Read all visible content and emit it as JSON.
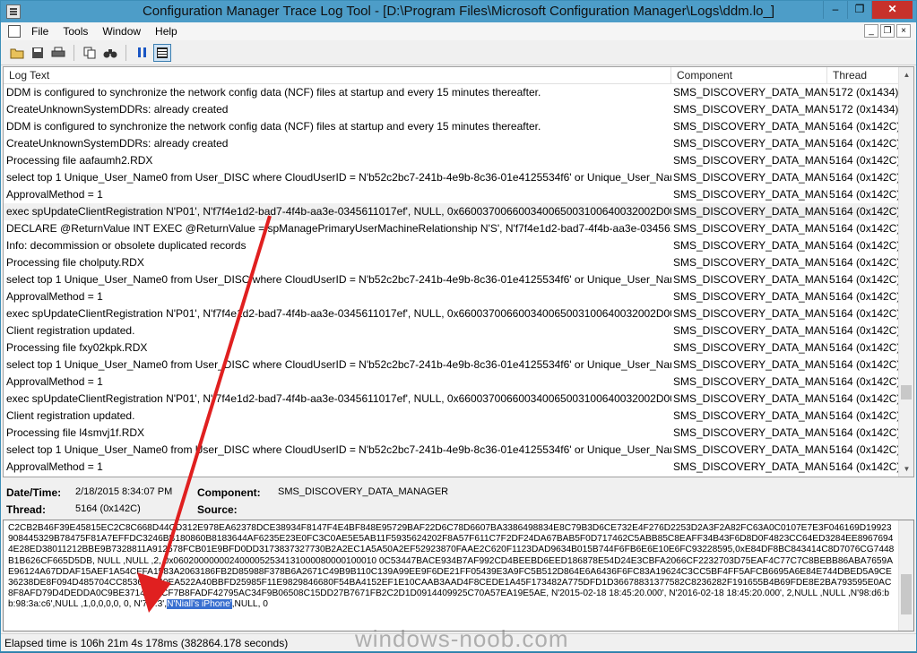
{
  "titlebar": {
    "title": "Configuration Manager Trace Log Tool - [D:\\Program Files\\Microsoft Configuration Manager\\Logs\\ddm.lo_]",
    "minimize": "–",
    "restore": "❐",
    "close": "✕"
  },
  "menu": {
    "file": "File",
    "tools": "Tools",
    "window": "Window",
    "help": "Help",
    "mdi_min": "_",
    "mdi_restore": "❐",
    "mdi_close": "×"
  },
  "columns": {
    "text": "Log Text",
    "component": "Component",
    "thread": "Thread"
  },
  "rows": [
    {
      "text": "DDM is configured to synchronize the network config data (NCF) files at startup and every 15 minutes thereafter.",
      "component": "SMS_DISCOVERY_DATA_MANA",
      "thread": "5172 (0x1434)"
    },
    {
      "text": "CreateUnknownSystemDDRs: already created",
      "component": "SMS_DISCOVERY_DATA_MANA",
      "thread": "5172 (0x1434)"
    },
    {
      "text": "DDM is configured to synchronize the network config data (NCF) files at startup and every 15 minutes thereafter.",
      "component": "SMS_DISCOVERY_DATA_MANA",
      "thread": "5164 (0x142C)"
    },
    {
      "text": "CreateUnknownSystemDDRs: already created",
      "component": "SMS_DISCOVERY_DATA_MANA",
      "thread": "5164 (0x142C)"
    },
    {
      "text": "Processing file aafaumh2.RDX",
      "component": "SMS_DISCOVERY_DATA_MANA",
      "thread": "5164 (0x142C)"
    },
    {
      "text": "select top 1 Unique_User_Name0 from User_DISC where CloudUserID = N'b52c2bc7-241b-4e9b-8c36-01e4125534f6' or Unique_User_Name...",
      "component": "SMS_DISCOVERY_DATA_MANA",
      "thread": "5164 (0x142C)"
    },
    {
      "text": "ApprovalMethod = 1",
      "component": "SMS_DISCOVERY_DATA_MANA",
      "thread": "5164 (0x142C)"
    },
    {
      "text": "exec spUpdateClientRegistration N'P01', N'f7f4e1d2-bad7-4f4b-aa3e-0345611017ef', NULL, 0x660037006600340065003100640032002D00620...",
      "component": "SMS_DISCOVERY_DATA_MANA",
      "thread": "5164 (0x142C)",
      "selected": true
    },
    {
      "text": "DECLARE @ReturnValue INT EXEC @ReturnValue = spManagePrimaryUserMachineRelationship N'S', N'f7f4e1d2-bad7-4f4b-aa3e-0345611...",
      "component": "SMS_DISCOVERY_DATA_MANA",
      "thread": "5164 (0x142C)"
    },
    {
      "text": "Info: decommission or obsolete duplicated records",
      "component": "SMS_DISCOVERY_DATA_MANA",
      "thread": "5164 (0x142C)"
    },
    {
      "text": "Processing file cholputy.RDX",
      "component": "SMS_DISCOVERY_DATA_MANA",
      "thread": "5164 (0x142C)"
    },
    {
      "text": "select top 1 Unique_User_Name0 from User_DISC where CloudUserID = N'b52c2bc7-241b-4e9b-8c36-01e4125534f6' or Unique_User_Name...",
      "component": "SMS_DISCOVERY_DATA_MANA",
      "thread": "5164 (0x142C)"
    },
    {
      "text": "ApprovalMethod = 1",
      "component": "SMS_DISCOVERY_DATA_MANA",
      "thread": "5164 (0x142C)"
    },
    {
      "text": "exec spUpdateClientRegistration N'P01', N'f7f4e1d2-bad7-4f4b-aa3e-0345611017ef', NULL, 0x660037006600340065003100640032002D00620...",
      "component": "SMS_DISCOVERY_DATA_MANA",
      "thread": "5164 (0x142C)"
    },
    {
      "text": "Client registration updated.",
      "component": "SMS_DISCOVERY_DATA_MANA",
      "thread": "5164 (0x142C)"
    },
    {
      "text": "Processing file fxy02kpk.RDX",
      "component": "SMS_DISCOVERY_DATA_MANA",
      "thread": "5164 (0x142C)"
    },
    {
      "text": "select top 1 Unique_User_Name0 from User_DISC where CloudUserID = N'b52c2bc7-241b-4e9b-8c36-01e4125534f6' or Unique_User_Name...",
      "component": "SMS_DISCOVERY_DATA_MANA",
      "thread": "5164 (0x142C)"
    },
    {
      "text": "ApprovalMethod = 1",
      "component": "SMS_DISCOVERY_DATA_MANA",
      "thread": "5164 (0x142C)"
    },
    {
      "text": "exec spUpdateClientRegistration N'P01', N'f7f4e1d2-bad7-4f4b-aa3e-0345611017ef', NULL, 0x660037006600340065003100640032002D00620...",
      "component": "SMS_DISCOVERY_DATA_MANA",
      "thread": "5164 (0x142C)"
    },
    {
      "text": "Client registration updated.",
      "component": "SMS_DISCOVERY_DATA_MANA",
      "thread": "5164 (0x142C)"
    },
    {
      "text": "Processing file l4smvj1f.RDX",
      "component": "SMS_DISCOVERY_DATA_MANA",
      "thread": "5164 (0x142C)"
    },
    {
      "text": "select top 1 Unique_User_Name0 from User_DISC where CloudUserID = N'b52c2bc7-241b-4e9b-8c36-01e4125534f6' or Unique_User_Name...",
      "component": "SMS_DISCOVERY_DATA_MANA",
      "thread": "5164 (0x142C)"
    },
    {
      "text": "ApprovalMethod = 1",
      "component": "SMS_DISCOVERY_DATA_MANA",
      "thread": "5164 (0x142C)"
    }
  ],
  "details": {
    "datetime_label": "Date/Time:",
    "datetime_value": "2/18/2015 8:34:07 PM",
    "component_label": "Component:",
    "component_value": "SMS_DISCOVERY_DATA_MANAGER",
    "thread_label": "Thread:",
    "thread_value": "5164 (0x142C)",
    "source_label": "Source:",
    "source_value": ""
  },
  "textpane": {
    "before": "C2CB2B46F39E45815EC2C8C668D44CD312E978EA62378DCE38934F8147F4E4BF848E95729BAF22D6C78D6607BA3386498834E8C79B3D6CE732E4F276D2253D2A3F2A82FC63A0C0107E7E3F046169D19923908445329B78475F81A7EFFDC3246BB180860B8183644AF6235E23E0FC3C0AE5E5AB11F5935624202F8A57F611C7F2DF24DA67BAB5F0D717462C5ABB85C8EAFF34B43F6D8D0F4823CC64ED3284EE89676944E28ED38011212BBE9B7328811A912578FCB01E9BFD0DD3173837327730B2A2EC1A5A50A2EF52923870FAAE2C620F1123DAD9634B015B744F6FB6E6E10E6FC93228595,0xE84DF8BC843414C8D7076CG7448B1B626CF665D5DB, NULL ,NULL ,2, 0x0602000000024000052534131000080000100010 0C53447BACE934B7AF992CD4BEEBD6EED186878E54D24E3CBFA2066CF2232703D75EAF4C77C7C8BEBB86ABA7659AE96124A67DDAF15AEF1A54CFFA1583A2063186FB2D85988F378B6A2671C49B9B110C139A99EE9F6DE21FF05439E3A9FC5B512D864E6A6436F6FC83A19624C3CC5BF4FF5AFCB6695A6E84E744DBED5A9CE36238DE8F094D485704CC853672240EA522A40BBFD25985F11E9829846680F54BA4152EF1E10CAAB3AAD4F8CEDE1A45F173482A775DFD1D36678831377582C8236282F191655B4B69FDE8E2BA793595E0AC8F8AFD79D4DEDDA0C9BE3714E56CF7B8FADF42795AC34F9B06508C15DD27B7671FB2C2D1D0914409925C70A57EA19E5AE, N'2015-02-18 18:45:20.000', N'2016-02-18 18:45:20.000', 2,NULL ,NULL ,N'98:d6:bb:98:3a:c6',NULL ,1,0,0,0,0, 0, N'7.0.3',",
    "highlight": "N'Niall's iPhone'",
    "after": ",NULL, 0"
  },
  "status": {
    "elapsed": "Elapsed time is 106h 21m 4s 178ms (382864.178 seconds)"
  },
  "watermark": "windows-noob.com"
}
